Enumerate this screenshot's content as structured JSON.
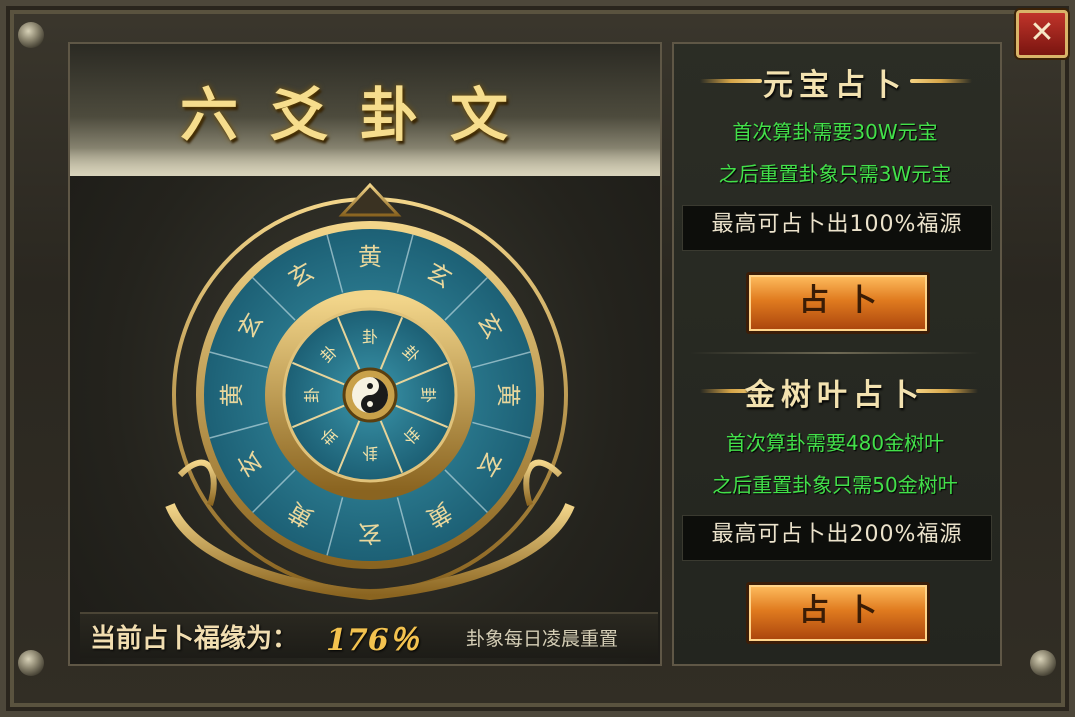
{
  "title": "六爻卦文",
  "close_label": "✕",
  "wheel": {
    "center_icon": "yin-yang-icon",
    "outer_glyphs": [
      "黄",
      "玄",
      "玄",
      "黄",
      "玄",
      "黄",
      "玄",
      "黄",
      "玄",
      "黄",
      "玄",
      "玄"
    ],
    "inner_glyphs": [
      "卦",
      "卦",
      "卦",
      "卦",
      "卦",
      "卦",
      "卦",
      "卦"
    ],
    "colors": {
      "face": "#1f6f86",
      "gold": "#c9a14a"
    }
  },
  "status": {
    "fortune_label": "当前占卜福缘为：",
    "fortune_value": "176％",
    "reset_note": "卦象每日凌晨重置"
  },
  "sections": [
    {
      "title": "元宝占卜",
      "line1": "首次算卦需要30W元宝",
      "line2": "之后重置卦象只需3W元宝",
      "cap": "最高可占卜出100%福源",
      "button": "占卜"
    },
    {
      "title": "金树叶占卜",
      "line1": "首次算卦需要480金树叶",
      "line2": "之后重置卦象只需50金树叶",
      "cap": "最高可占卜出200%福源",
      "button": "占卜"
    }
  ]
}
